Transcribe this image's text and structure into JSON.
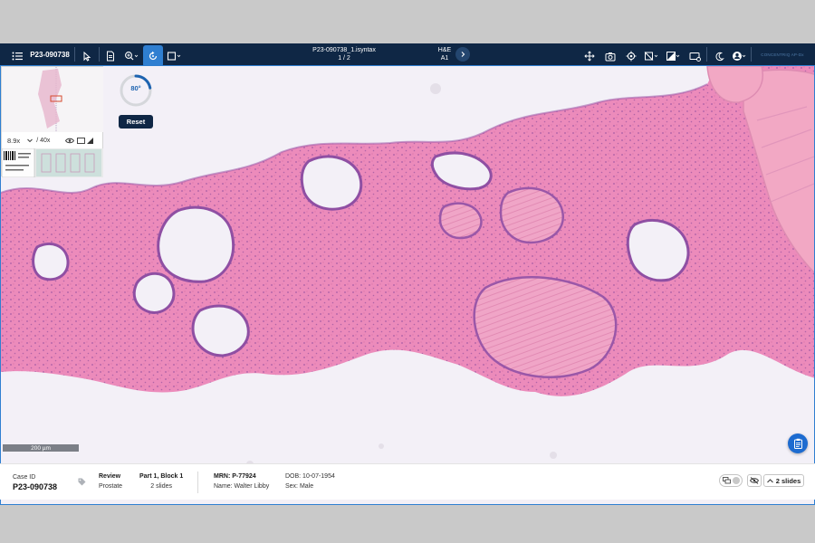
{
  "toolbar": {
    "case_id": "P23-090738",
    "file_name": "P23-090738_1.isyntax",
    "page_indicator": "1 / 2",
    "stain": "H&E",
    "block": "A1",
    "brand": "CONCENTRIQ AP-Dx",
    "icons": [
      "menu-icon",
      "pointer-icon",
      "slide-info-icon",
      "zoom-icon",
      "rotate-icon",
      "square-icon",
      "pan-icon",
      "snapshot-icon",
      "target-icon",
      "hide-annotations-icon",
      "image-adjust-icon",
      "screen-icon",
      "moon-icon",
      "user-icon"
    ],
    "accent": "#2f7fd1",
    "bar_color": "#0f2745"
  },
  "overview": {
    "zoom_current": "8.9x",
    "zoom_max": "/ 40x"
  },
  "rotation": {
    "value": "80°",
    "fraction": 0.222,
    "reset_label": "Reset"
  },
  "scalebar": {
    "label": "200 µm"
  },
  "footer": {
    "case_id_label": "Case ID",
    "case_id": "P23-090738",
    "status": "Review",
    "specimen": "Prostate",
    "part_block": "Part 1, Block 1",
    "slide_count": "2 slides",
    "mrn": "MRN: P-77924",
    "name": "Name: Walter Libby",
    "dob": "DOB: 10-07-1954",
    "sex": "Sex: Male",
    "slides_button": "2 slides"
  }
}
